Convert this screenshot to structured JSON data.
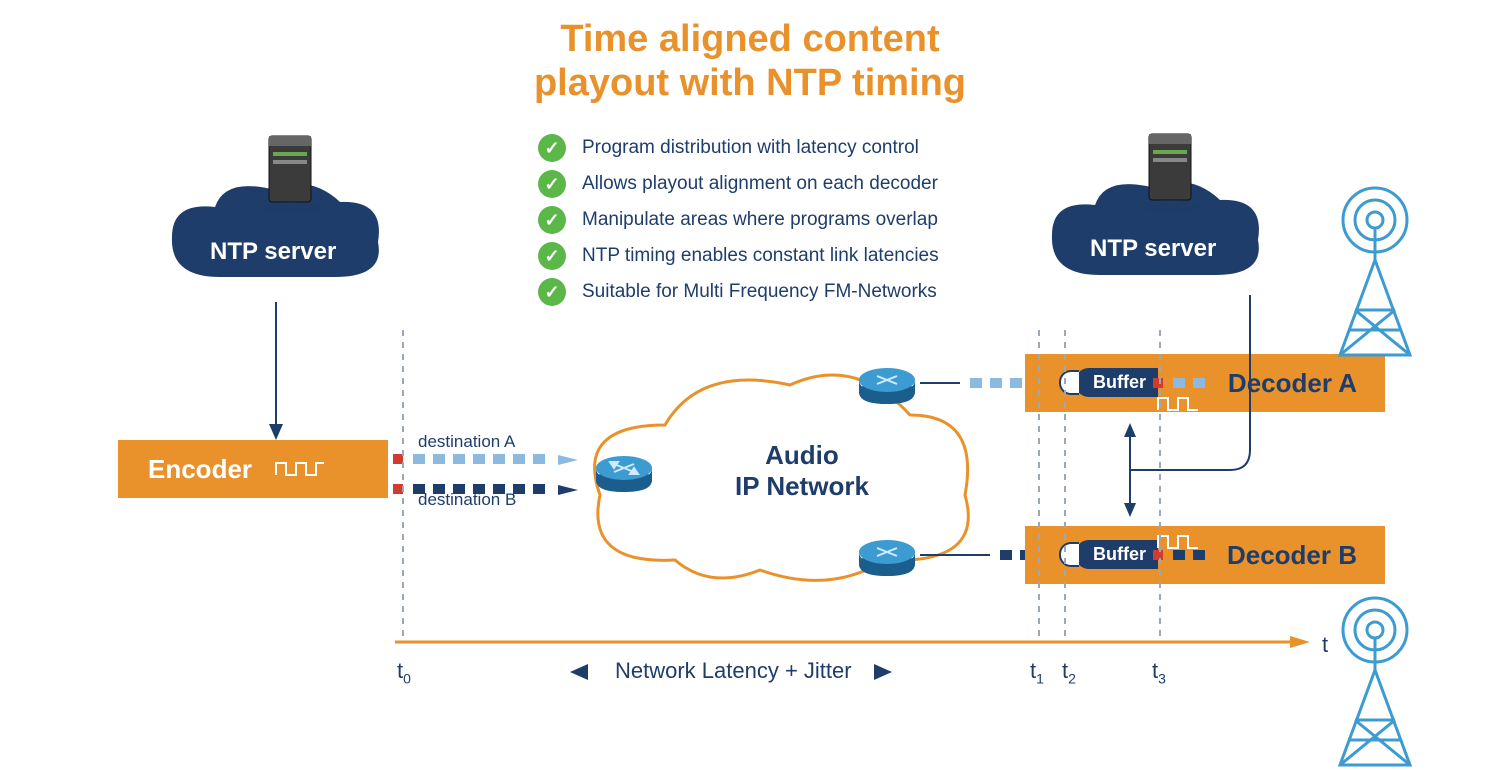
{
  "title_line1": "Time aligned content",
  "title_line2": "playout with NTP timing",
  "bullets": [
    "Program distribution with latency control",
    "Allows playout alignment on each decoder",
    "Manipulate areas where programs overlap",
    "NTP timing enables constant link latencies",
    "Suitable for Multi Frequency FM-Networks"
  ],
  "ntp_server_label": "NTP server",
  "encoder_label": "Encoder",
  "decoder_a_label": "Decoder A",
  "decoder_b_label": "Decoder B",
  "buffer_label": "Buffer",
  "destination_a": "destination A",
  "destination_b": "destination B",
  "cloud_label_line1": "Audio",
  "cloud_label_line2": "IP Network",
  "timeline": {
    "t0": "t",
    "t0_sub": "0",
    "t1": "t",
    "t1_sub": "1",
    "t2": "t",
    "t2_sub": "2",
    "t3": "t",
    "t3_sub": "3",
    "t_end": "t",
    "latency_label": "Network Latency + Jitter"
  },
  "colors": {
    "orange": "#E9922B",
    "navy": "#1E3D6B",
    "green": "#5CB749",
    "lightblue": "#8CB9E0",
    "red": "#D43A2E",
    "routerblue": "#2D7CB5"
  }
}
